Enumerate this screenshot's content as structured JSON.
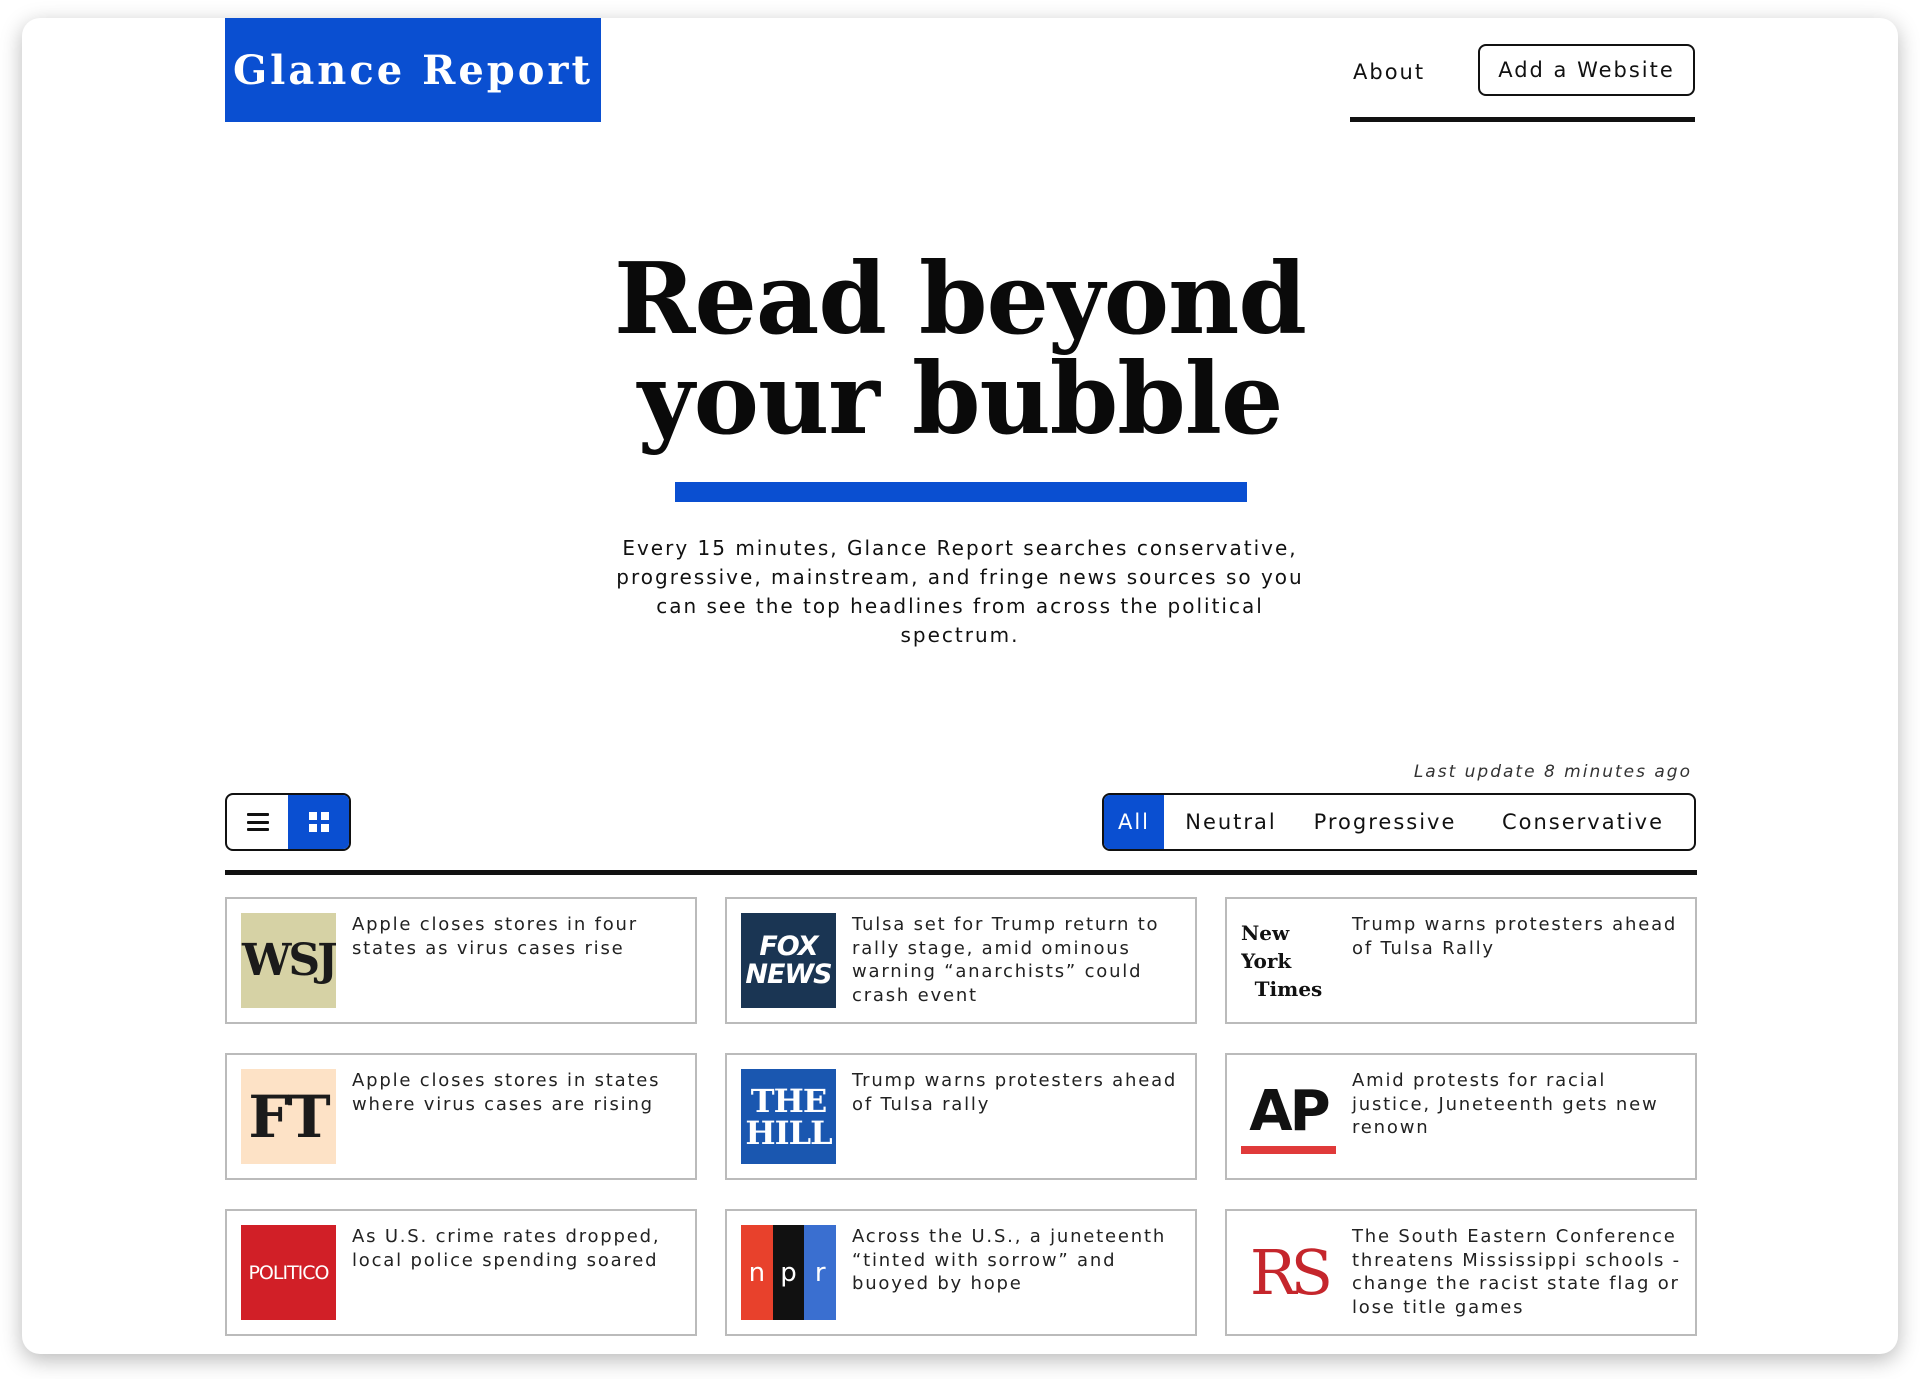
{
  "header": {
    "logo": "Glance Report",
    "nav_about": "About",
    "nav_add": "Add a Website"
  },
  "hero": {
    "title_line1": "Read beyond",
    "title_line2": "your bubble",
    "description": "Every 15 minutes, Glance Report searches conservative, progressive, mainstream, and fringe news sources so you can see the top headlines from across the political spectrum."
  },
  "toolbar": {
    "last_update": "Last update 8 minutes ago",
    "view_modes": [
      "list",
      "grid"
    ],
    "active_view": "grid",
    "filters": [
      "All",
      "Neutral",
      "Progressive",
      "Conservative"
    ],
    "active_filter": "All"
  },
  "colors": {
    "accent": "#0a4fd1",
    "text": "#111111",
    "card_border": "#bbbbbb"
  },
  "articles": [
    {
      "source_logo": "WSJ",
      "headline": "Apple closes stores in four states as virus cases rise"
    },
    {
      "source_logo_line1": "FOX",
      "source_logo_line2": "NEWS",
      "headline": "Tulsa set for Trump return to rally stage, amid ominous warning “anarchists” could crash event"
    },
    {
      "source_logo_line1": "New York",
      "source_logo_line2": "Times",
      "headline": "Trump warns protesters ahead of Tulsa Rally"
    },
    {
      "source_logo": "FT",
      "headline": "Apple closes stores in states where virus cases are rising"
    },
    {
      "source_logo_line1": "THE",
      "source_logo_line2": "HILL",
      "headline": "Trump warns protesters ahead of Tulsa rally"
    },
    {
      "source_logo": "AP",
      "headline": "Amid protests for racial justice, Juneteenth gets new renown"
    },
    {
      "source_logo": "POLITICO",
      "headline": "As U.S. crime rates dropped, local police spending soared"
    },
    {
      "source_logo_letters": [
        "n",
        "p",
        "r"
      ],
      "headline": "Across the U.S., a juneteenth “tinted with sorrow” and buoyed by hope"
    },
    {
      "source_logo": "RS",
      "headline": "The South Eastern Conference threatens Mississippi schools - change the racist state flag or lose title games"
    }
  ]
}
